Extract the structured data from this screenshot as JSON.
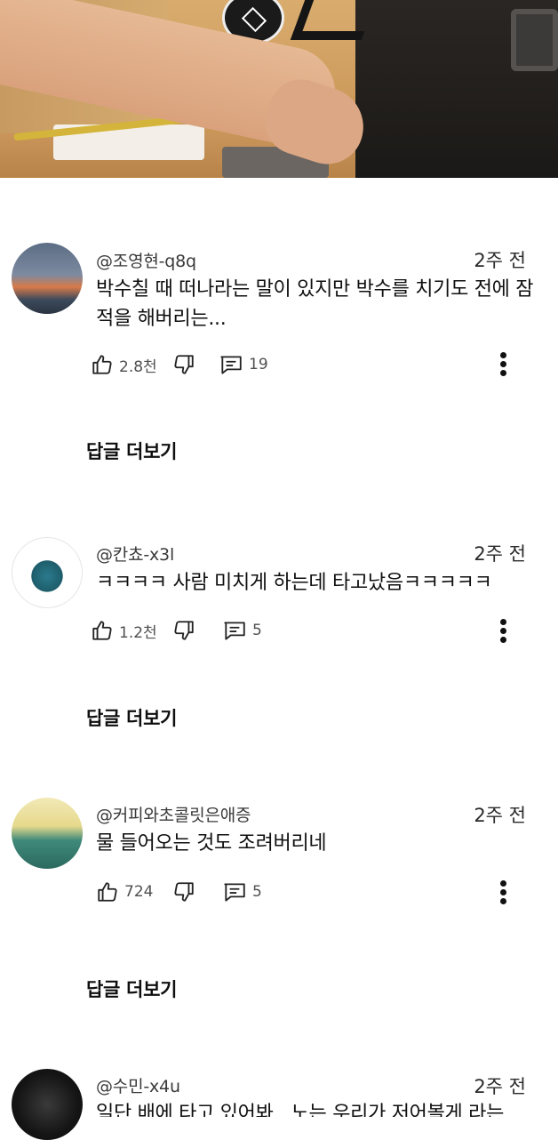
{
  "comments": [
    {
      "author": "@조영현-q8q",
      "time": "2주 전",
      "text": "박수칠 때 떠나라는 말이 있지만 박수를 치기도 전에 잠적을 해버리는...",
      "likes": "2.8천",
      "reply_count": "19",
      "more_replies": "답글 더보기"
    },
    {
      "author": "@칸쵸-x3l",
      "time": "2주 전",
      "text": "ㅋㅋㅋㅋ 사람 미치게 하는데 타고났음ㅋㅋㅋㅋㅋ",
      "likes": "1.2천",
      "reply_count": "5",
      "more_replies": "답글 더보기"
    },
    {
      "author": "@커피와초콜릿은애증",
      "time": "2주 전",
      "text": "물 들어오는 것도 조려버리네",
      "likes": "724",
      "reply_count": "5",
      "more_replies": "답글 더보기"
    },
    {
      "author": "@수민-x4u",
      "time": "2주 전",
      "text": "일단 배에 타고 있어봐.. 노는 우리가 저어볼게 라는"
    }
  ],
  "icons": {
    "like": "thumbs-up-icon",
    "dislike": "thumbs-down-icon",
    "reply": "reply-comment-icon",
    "more": "more-vert-icon"
  }
}
